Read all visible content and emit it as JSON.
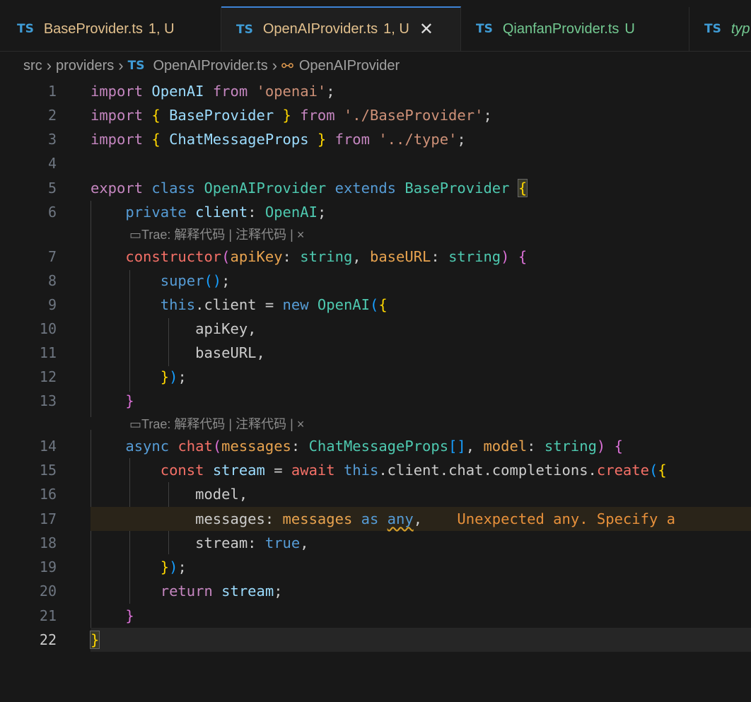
{
  "tabs": [
    {
      "name": "BaseProvider.ts",
      "status": "1, U",
      "badge": "TS"
    },
    {
      "name": "OpenAIProvider.ts",
      "status": "1, U",
      "badge": "TS"
    },
    {
      "name": "QianfanProvider.ts",
      "status": "U",
      "badge": "TS"
    },
    {
      "name": "typ",
      "status": "",
      "badge": "TS"
    }
  ],
  "breadcrumb": {
    "src": "src",
    "providers": "providers",
    "file": "OpenAIProvider.ts",
    "symbol": "OpenAIProvider",
    "badge": "TS"
  },
  "lens": {
    "prefix": "Trae:",
    "explain": "解释代码",
    "sep": "|",
    "comment": "注释代码",
    "close": "×"
  },
  "lines": [
    "1",
    "2",
    "3",
    "4",
    "5",
    "6",
    "7",
    "8",
    "9",
    "10",
    "11",
    "12",
    "13",
    "14",
    "15",
    "16",
    "17",
    "18",
    "19",
    "20",
    "21",
    "22"
  ],
  "code": {
    "l1": [
      "import",
      "OpenAI",
      "from",
      "'openai'",
      ";"
    ],
    "l2": [
      "import",
      "{",
      "BaseProvider",
      "}",
      "from",
      "'./BaseProvider'",
      ";"
    ],
    "l3": [
      "import",
      "{",
      "ChatMessageProps",
      "}",
      "from",
      "'../type'",
      ";"
    ],
    "l5": [
      "export",
      "class",
      "OpenAIProvider",
      "extends",
      "BaseProvider",
      "{"
    ],
    "l6": [
      "private",
      "client",
      ":",
      "OpenAI",
      ";"
    ],
    "l7": [
      "constructor",
      "(",
      "apiKey",
      ":",
      "string",
      ",",
      "baseURL",
      ":",
      "string",
      ")",
      "{"
    ],
    "l8": [
      "super",
      "()",
      ";"
    ],
    "l9": [
      "this",
      ".client = ",
      "new",
      "OpenAI",
      "(",
      "{"
    ],
    "l10": [
      "apiKey,"
    ],
    "l11": [
      "baseURL,"
    ],
    "l12": [
      "}",
      ")",
      ";"
    ],
    "l13": [
      "}"
    ],
    "l14": [
      "async",
      "chat",
      "(",
      "messages",
      ":",
      "ChatMessageProps",
      "[]",
      ",",
      "model",
      ":",
      "string",
      ")",
      "{"
    ],
    "l15": [
      "const",
      "stream",
      "=",
      "await",
      "this",
      ".client.chat.completions.",
      "create",
      "(",
      "{"
    ],
    "l16": [
      "model,"
    ],
    "l17": [
      "messages",
      ":",
      "messages",
      "as",
      "any",
      ","
    ],
    "l17_diag": "Unexpected any. Specify a",
    "l18": [
      "stream",
      ":",
      "true",
      ","
    ],
    "l19": [
      "}",
      ")",
      ";"
    ],
    "l20": [
      "return",
      "stream",
      ";"
    ],
    "l21": [
      "}"
    ],
    "l22": [
      "}"
    ]
  }
}
